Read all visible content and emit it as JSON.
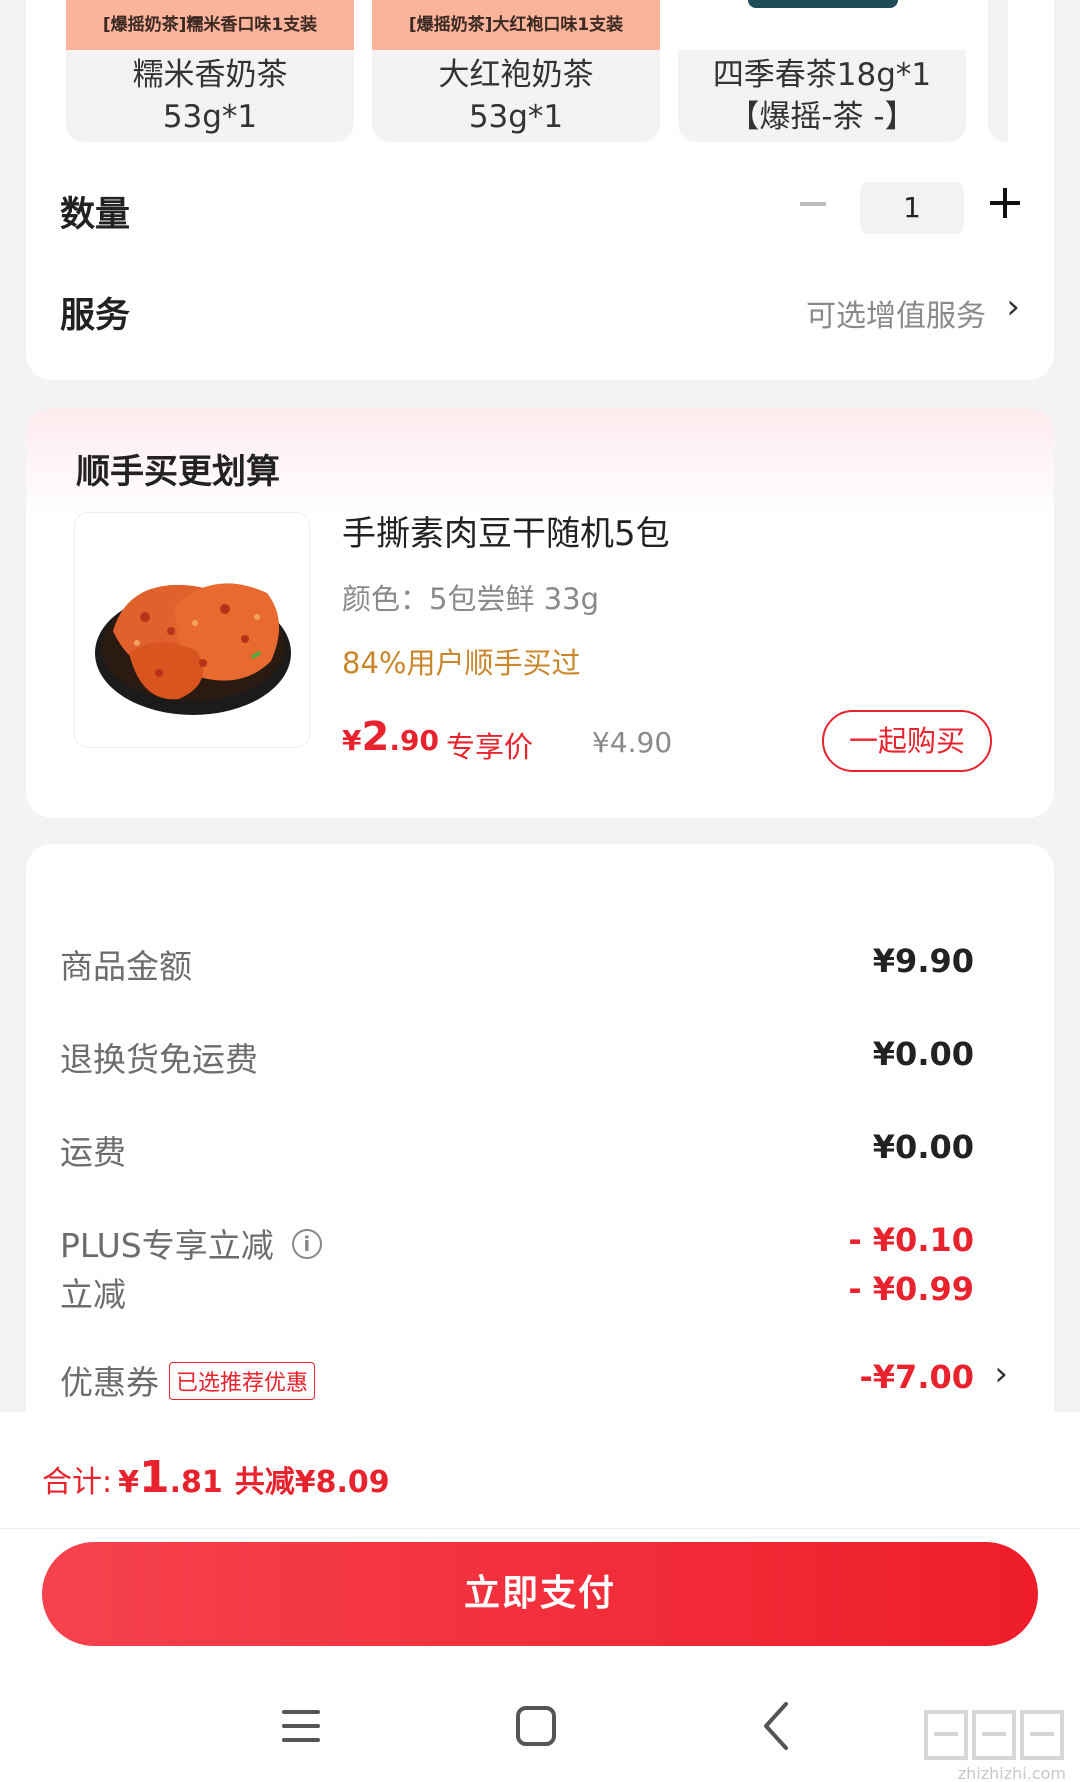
{
  "variants": [
    {
      "tag": "[爆摇奶茶]糯米香口味1支装",
      "name_line1": "糯米香奶茶",
      "name_line2": "53g*1"
    },
    {
      "tag": "[爆摇奶茶]大红袍口味1支装",
      "name_line1": "大红袍奶茶",
      "name_line2": "53g*1"
    },
    {
      "tag": "",
      "name_line1": "四季春茶18g*1",
      "name_line2": "【爆摇-茶 -】"
    }
  ],
  "quantity": {
    "label": "数量",
    "value": "1"
  },
  "service": {
    "label": "服务",
    "hint": "可选增值服务",
    "chevron": "›"
  },
  "bundle": {
    "title": "顺手买更划算",
    "name": "手撕素肉豆干随机5包",
    "spec": "颜色：5包尝鲜 33g",
    "social": "84%用户顺手买过",
    "price_symbol": "¥",
    "price_int": "2",
    "price_dec": ".90",
    "price_tag": "专享价",
    "old_price": "¥4.90",
    "buy_label": "一起购买"
  },
  "details": [
    {
      "label": "商品金额",
      "value": "¥9.90",
      "red": false
    },
    {
      "label": "退换货免运费",
      "value": "¥0.00",
      "red": false
    },
    {
      "label": "运费",
      "value": "¥0.00",
      "red": false
    },
    {
      "label": "PLUS专享立减",
      "value": "- ¥0.10",
      "red": true
    },
    {
      "label": "立减",
      "value": "- ¥0.99",
      "red": true
    },
    {
      "label": "优惠券",
      "value": "-¥7.00",
      "red": true,
      "badge": "已选推荐优惠"
    }
  ],
  "info_glyph": "i",
  "total": {
    "label": "合计:",
    "symbol": "¥",
    "int": "1",
    "dec": ".81",
    "saving": "共减¥8.09"
  },
  "pay_button": "立即支付",
  "watermark": {
    "site": "zhizhizhi.com"
  },
  "colors": {
    "accent": "#e8232d",
    "social": "#c9862a",
    "tag_bg": "#fbb39b"
  },
  "icons": [
    "minus-icon",
    "plus-icon",
    "chevron-right-icon",
    "info-icon",
    "menu-icon",
    "home-icon",
    "back-icon"
  ]
}
